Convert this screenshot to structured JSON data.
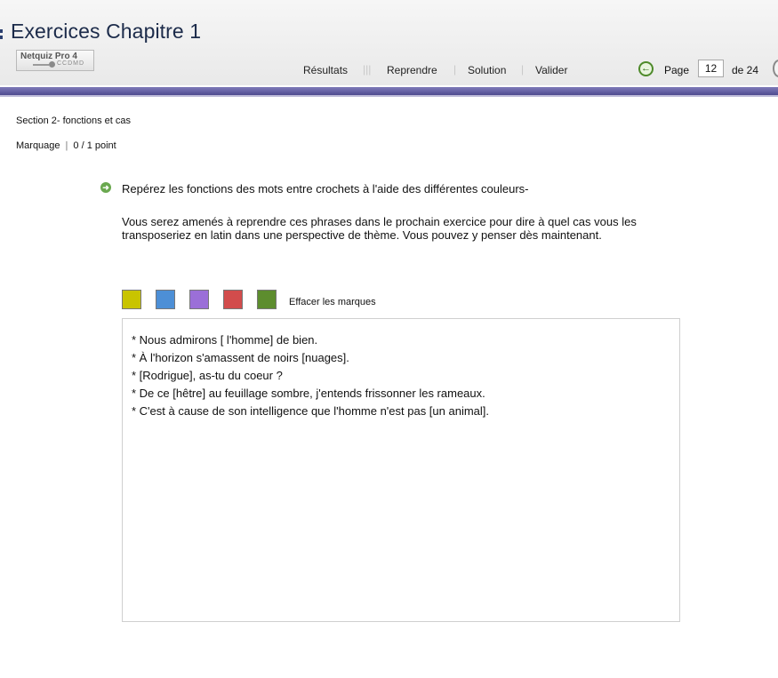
{
  "header": {
    "title": "Exercices Chapitre 1",
    "logo": {
      "name": "Netquiz Pro 4",
      "sub": "CCDMD"
    },
    "nav": {
      "results": "Résultats",
      "restart": "Reprendre",
      "solution": "Solution",
      "validate": "Valider"
    },
    "pagination": {
      "label": "Page",
      "current": "12",
      "of_label": "de 24"
    }
  },
  "section": {
    "title": "Section 2- fonctions et cas"
  },
  "marking": {
    "label": "Marquage",
    "separator": "|",
    "score": "0 / 1 point"
  },
  "question": {
    "instruction": "Repérez les fonctions des mots entre crochets à l'aide des différentes couleurs-",
    "paragraph": "Vous serez amenés à reprendre ces phrases dans le prochain exercice pour dire à quel cas vous les transposeriez en latin dans une perspective de thème. Vous pouvez y penser dès maintenant."
  },
  "palette": {
    "colors": [
      "#c9c400",
      "#4d8fd6",
      "#9b6fd8",
      "#d24c4c",
      "#5d8d2e"
    ],
    "clear_label": "Effacer les marques"
  },
  "sentences": [
    "* Nous admirons [ l'homme] de bien.",
    "* À l'horizon s'amassent de noirs [nuages].",
    "* [Rodrigue], as-tu du coeur ?",
    "* De ce [hêtre] au feuillage sombre, j'entends frissonner les rameaux.",
    "* C'est à cause de son intelligence que l'homme n'est pas [un animal]."
  ]
}
